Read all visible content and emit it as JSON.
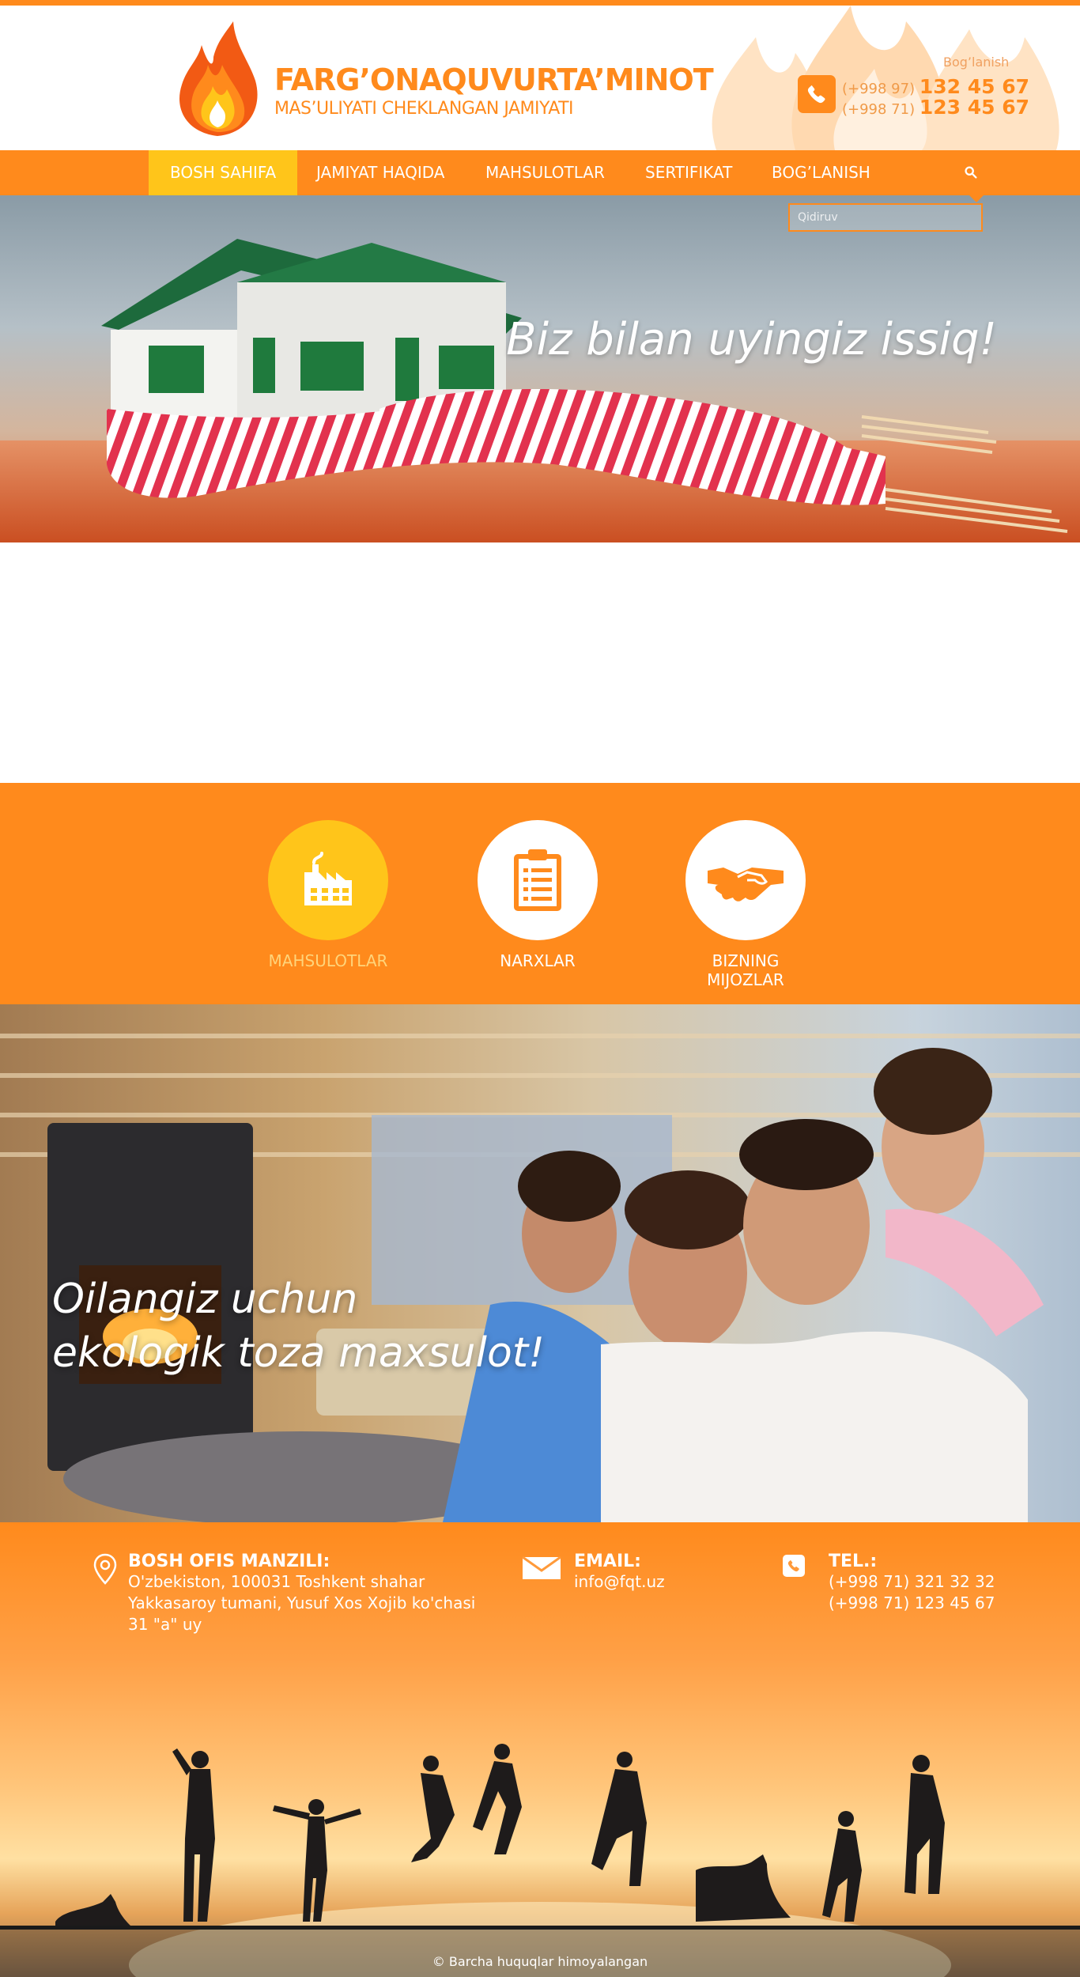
{
  "header": {
    "brand_title": "FARG’ONAQUVURTA’MINOT",
    "brand_subtitle": "MAS’ULIYATI CHEKLANGAN JAMIYATI",
    "contact_label": "Bog’lanish",
    "phones": [
      {
        "prefix": "(+998 97)",
        "number": "132 45 67"
      },
      {
        "prefix": "(+998 71)",
        "number": "123 45 67"
      }
    ]
  },
  "nav": {
    "items": [
      {
        "label": "BOSH SAHIFA",
        "active": true
      },
      {
        "label": "JAMIYAT HAQIDA",
        "active": false
      },
      {
        "label": "MAHSULOTLAR",
        "active": false
      },
      {
        "label": "SERTIFIKAT",
        "active": false
      },
      {
        "label": "BOG’LANISH",
        "active": false
      }
    ],
    "search_placeholder": "Qidiruv"
  },
  "hero": {
    "text": "Biz bilan uyingiz issiq!"
  },
  "features": [
    {
      "label": "MAHSULOTLAR",
      "icon": "factory-icon",
      "active": true
    },
    {
      "label": "NARXLAR",
      "icon": "clipboard-icon",
      "active": false
    },
    {
      "label": "BIZNING MIJOZLAR",
      "icon": "handshake-icon",
      "active": false
    }
  ],
  "family": {
    "line1": "Oilangiz uchun",
    "line2": "ekologik toza maxsulot!"
  },
  "footer": {
    "address_title": "BOSH OFIS MANZILI:",
    "address_lines": [
      "O'zbekiston, 100031 Toshkent shahar",
      "Yakkasaroy tumani, Yusuf Xos Xojib ko'chasi",
      "31 \"a\" uy"
    ],
    "email_title": "EMAIL:",
    "email": "info@fqt.uz",
    "tel_title": "TEL.:",
    "tels": [
      "(+998 71) 321 32 32",
      "(+998 71) 123 45 67"
    ],
    "copyright": "© Barcha huquqlar himoyalangan"
  },
  "colors": {
    "brand_orange": "#ff8a1c",
    "accent_yellow": "#ffc51a"
  }
}
